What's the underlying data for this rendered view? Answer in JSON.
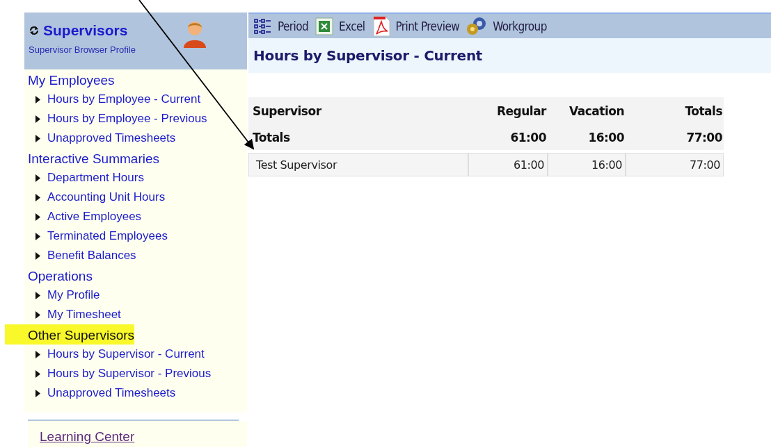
{
  "sidebar": {
    "title": "Supervisors",
    "subtitle": "Supervisor Browser Profile",
    "sections": [
      {
        "heading": "My Employees",
        "highlighted": false,
        "items": [
          "Hours by Employee - Current",
          "Hours by Employee - Previous",
          "Unapproved Timesheets"
        ]
      },
      {
        "heading": "Interactive Summaries",
        "highlighted": false,
        "items": [
          "Department Hours",
          "Accounting Unit Hours",
          "Active Employees",
          "Terminated Employees",
          "Benefit Balances"
        ]
      },
      {
        "heading": "Operations",
        "highlighted": false,
        "items": [
          "My Profile",
          "My Timesheet"
        ]
      },
      {
        "heading": "Other Supervisors",
        "highlighted": true,
        "items": [
          "Hours by Supervisor - Current",
          "Hours by Supervisor - Previous",
          "Unapproved Timesheets"
        ]
      }
    ],
    "footer_link": "Learning Center"
  },
  "toolbar": {
    "buttons": [
      {
        "kind": "period",
        "label": "Period"
      },
      {
        "kind": "excel",
        "label": "Excel"
      },
      {
        "kind": "pdf",
        "label": "Print Preview"
      },
      {
        "kind": "workgroup",
        "label": "Workgroup"
      }
    ]
  },
  "page_title": "Hours by Supervisor - Current",
  "table": {
    "columns": [
      "Supervisor",
      "Regular",
      "Vacation",
      "Totals"
    ],
    "totals": [
      "Totals",
      "61:00",
      "16:00",
      "77:00"
    ],
    "rows": [
      [
        "Test Supervisor",
        "61:00",
        "16:00",
        "77:00"
      ]
    ]
  }
}
